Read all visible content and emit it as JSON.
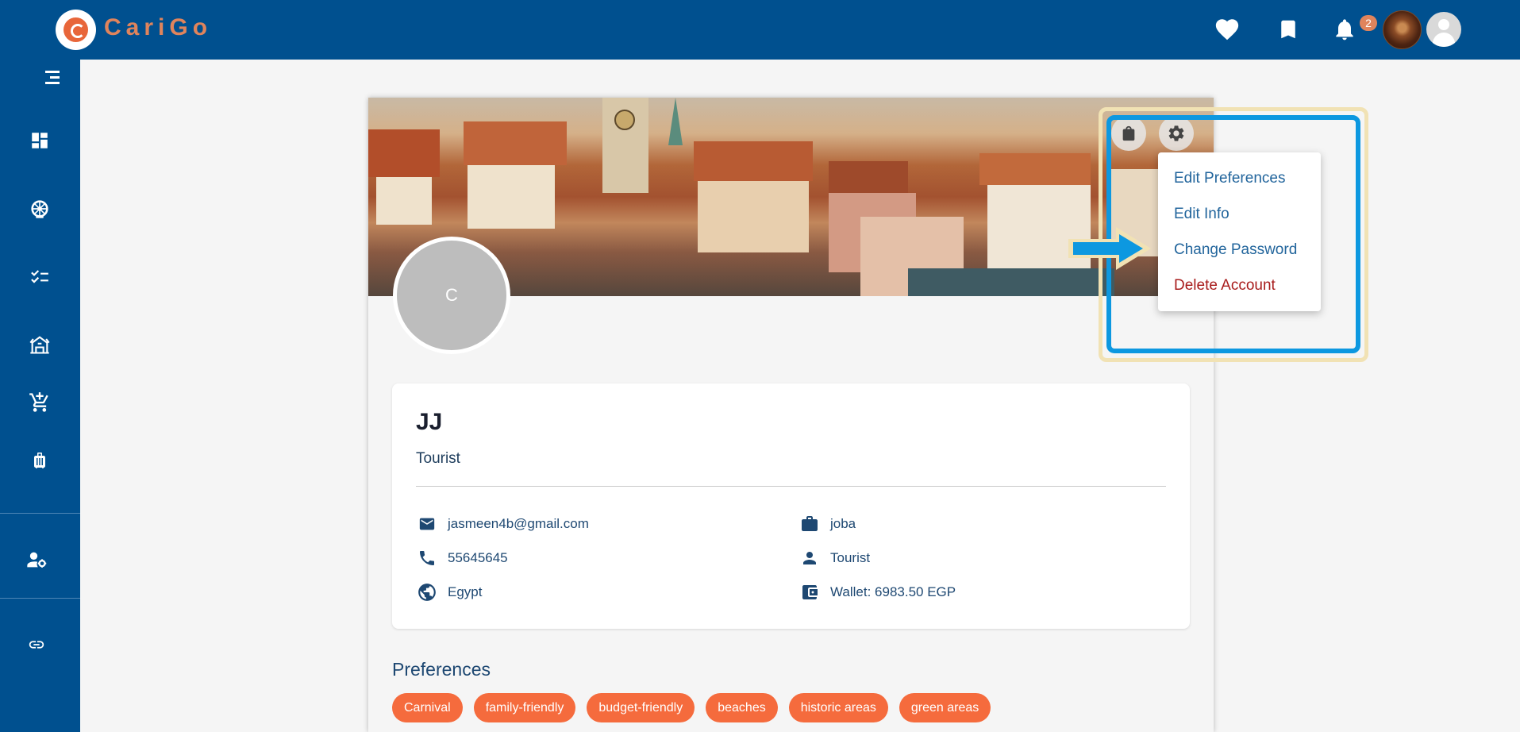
{
  "app": {
    "brand": "CariGo"
  },
  "topbar": {
    "notification_count": "2"
  },
  "profile": {
    "avatar_initial": "C",
    "name": "JJ",
    "role": "Tourist",
    "email": "jasmeen4b@gmail.com",
    "job": "joba",
    "phone": "55645645",
    "user_type": "Tourist",
    "country": "Egypt",
    "wallet": "Wallet: 6983.50 EGP"
  },
  "menu": {
    "items": [
      "Edit Preferences",
      "Edit Info",
      "Change Password",
      "Delete Account"
    ]
  },
  "preferences": {
    "title": "Preferences",
    "tags": [
      "Carnival",
      "family-friendly",
      "budget-friendly",
      "beaches",
      "historic areas",
      "green areas"
    ]
  },
  "colors": {
    "primary": "#00508f",
    "accent": "#f56b3d",
    "highlight": "#0d98e0"
  }
}
